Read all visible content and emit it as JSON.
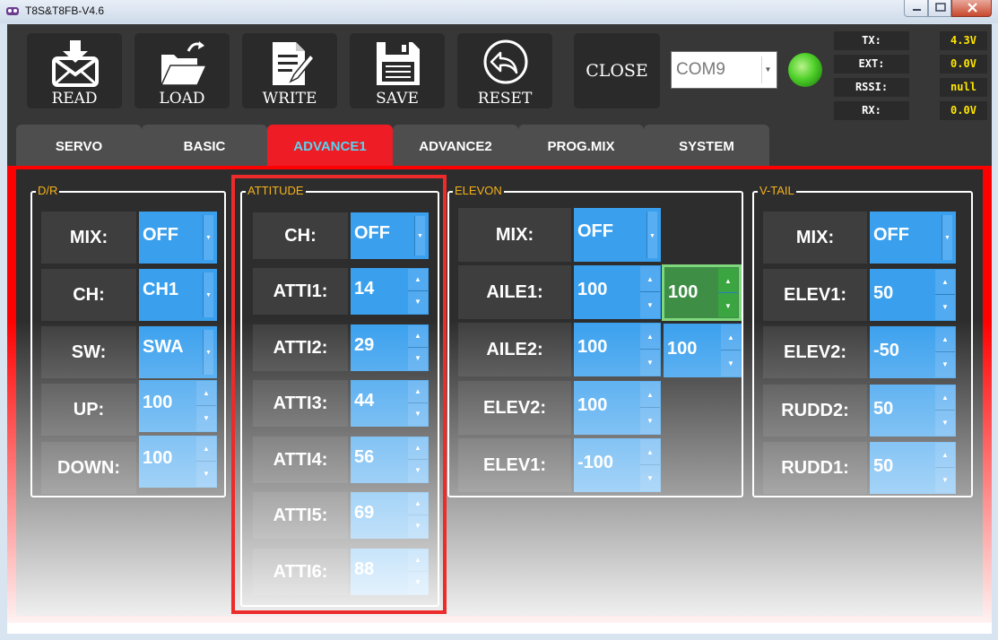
{
  "window": {
    "title": "T8S&T8FB-V4.6"
  },
  "toolbar": {
    "read": "READ",
    "load": "LOAD",
    "write": "WRITE",
    "save": "SAVE",
    "reset": "RESET",
    "close": "CLOSE"
  },
  "port": {
    "value": "COM9"
  },
  "status": {
    "tx_label": "TX:",
    "tx_value": "4.3V",
    "ext_label": "EXT:",
    "ext_value": "0.0V",
    "rssi_label": "RSSI:",
    "rssi_value": "null",
    "rx_label": "RX:",
    "rx_value": "0.0V"
  },
  "tabs": [
    "SERVO",
    "BASIC",
    "ADVANCE1",
    "ADVANCE2",
    "PROG.MIX",
    "SYSTEM"
  ],
  "active_tab": "ADVANCE1",
  "dr": {
    "title": "D/R",
    "rows": [
      {
        "label": "MIX:",
        "value": "OFF"
      },
      {
        "label": "CH:",
        "value": "CH1"
      },
      {
        "label": "SW:",
        "value": "SWA"
      },
      {
        "label": "UP:",
        "value": "100"
      },
      {
        "label": "DOWN:",
        "value": "100"
      }
    ]
  },
  "attitude": {
    "title": "ATTITUDE",
    "rows": [
      {
        "label": "CH:",
        "value": "OFF"
      },
      {
        "label": "ATTI1:",
        "value": "14"
      },
      {
        "label": "ATTI2:",
        "value": "29"
      },
      {
        "label": "ATTI3:",
        "value": "44"
      },
      {
        "label": "ATTI4:",
        "value": "56"
      },
      {
        "label": "ATTI5:",
        "value": "69"
      },
      {
        "label": "ATTI6:",
        "value": "88"
      }
    ]
  },
  "elevon": {
    "title": "ELEVON",
    "rows": [
      {
        "label": "MIX:",
        "value": "OFF"
      },
      {
        "label": "AILE1:",
        "value": "100",
        "value2": "100"
      },
      {
        "label": "AILE2:",
        "value": "100",
        "value2": "100"
      },
      {
        "label": "ELEV2:",
        "value": "100"
      },
      {
        "label": "ELEV1:",
        "value": "-100"
      }
    ]
  },
  "vtail": {
    "title": "V-TAIL",
    "rows": [
      {
        "label": "MIX:",
        "value": "OFF"
      },
      {
        "label": "ELEV1:",
        "value": "50"
      },
      {
        "label": "ELEV2:",
        "value": "-50"
      },
      {
        "label": "RUDD2:",
        "value": "50"
      },
      {
        "label": "RUDD1:",
        "value": "50"
      }
    ]
  },
  "colors": {
    "accent_red": "#ff0000",
    "control_blue": "#3aa0ee",
    "group_title": "#f5b21a",
    "status_value": "#ffe600",
    "active_tab_text": "#58d4f0",
    "selected_green": "#3f8e46"
  },
  "icons": {
    "read": "envelope-download-icon",
    "load": "folder-open-icon",
    "write": "document-pen-icon",
    "save": "floppy-icon",
    "reset": "circle-undo-icon"
  }
}
